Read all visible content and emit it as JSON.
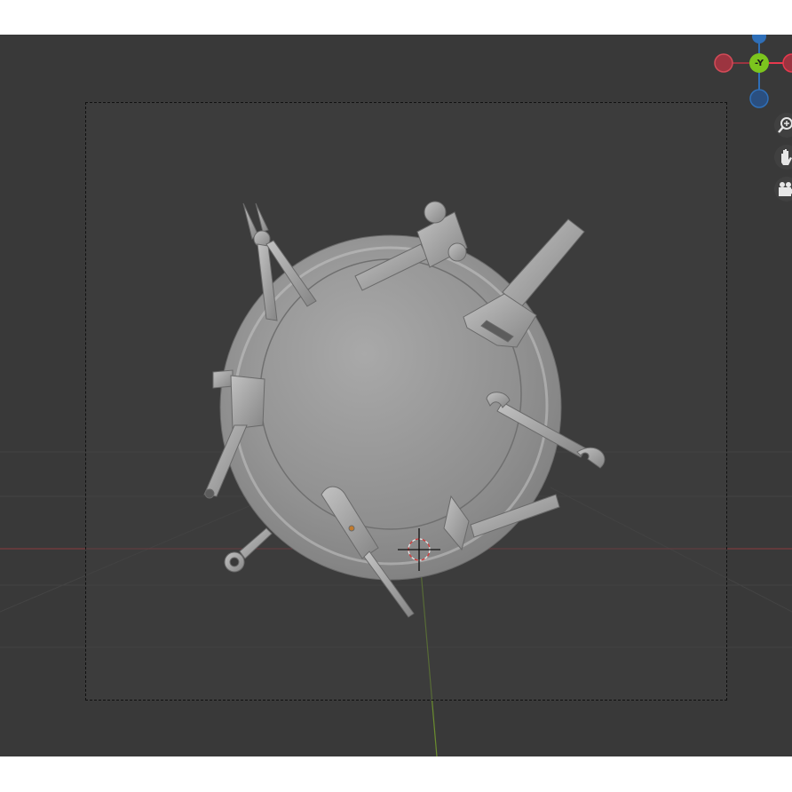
{
  "viewport": {
    "background": "#393939",
    "frame_border": "#111111"
  },
  "gizmo": {
    "y_axis_label": "-Y",
    "colors": {
      "x_axis": "#e8394e",
      "x_axis_negative": "#9c3440",
      "y_axis": "#7cc51e",
      "z_axis": "#2f6fb8"
    }
  },
  "nav_tools": {
    "icons": [
      "zoom-icon",
      "hand-pan-icon",
      "camera-view-icon"
    ]
  },
  "model": {
    "tools": [
      "pliers",
      "hammer",
      "saw",
      "wrench",
      "pipe-wrench",
      "screwdriver",
      "small-hammer",
      "spanner"
    ],
    "base_color": "#9a9a9a"
  }
}
